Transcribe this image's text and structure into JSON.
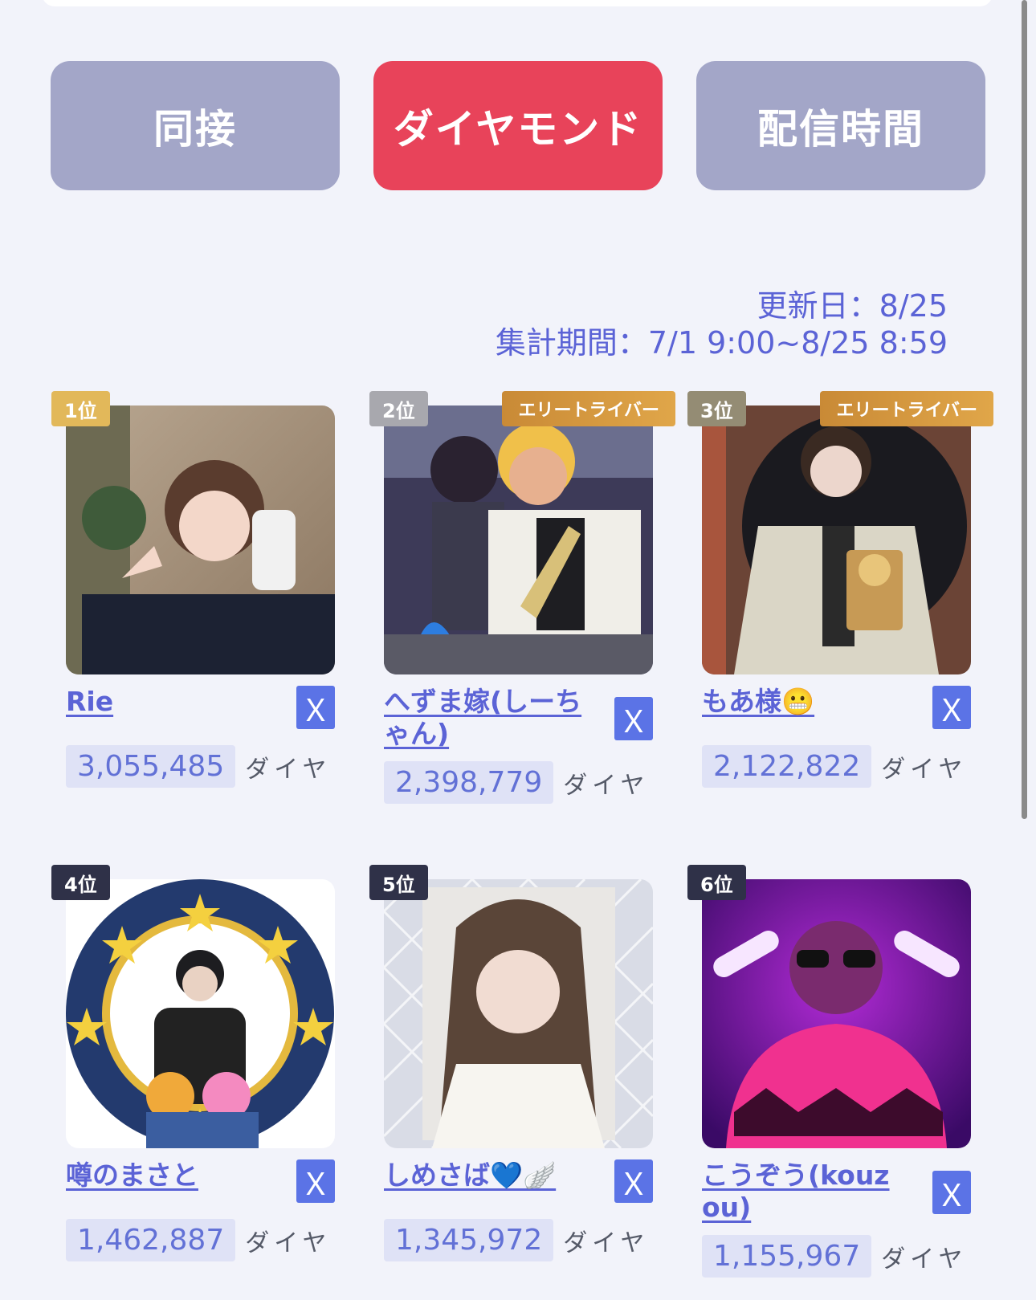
{
  "tabs": [
    {
      "label": "同接",
      "active": false
    },
    {
      "label": "ダイヤモンド",
      "active": true
    },
    {
      "label": "配信時間",
      "active": false
    }
  ],
  "updated": "更新日：8/25",
  "period": "集計期間：7/1 9:00~8/25 8:59",
  "unit_label": "ダイヤ",
  "x_icon": "Ｘ",
  "colors": {
    "active_tab": "#e8435a",
    "inactive_tab": "#a3a6c8",
    "accent": "#5b63d6",
    "elite_badge": "#d9993f"
  },
  "entries": [
    {
      "rank": "1位",
      "name": "Rie",
      "score": "3,055,485",
      "elite": ""
    },
    {
      "rank": "2位",
      "name": "へずま嫁(しーちゃん)",
      "score": "2,398,779",
      "elite": "エリートライバー"
    },
    {
      "rank": "3位",
      "name": "もあ様😬",
      "score": "2,122,822",
      "elite": "エリートライバー"
    },
    {
      "rank": "4位",
      "name": "噂のまさと",
      "score": "1,462,887",
      "elite": ""
    },
    {
      "rank": "5位",
      "name": "しめさば💙🪽",
      "score": "1,345,972",
      "elite": ""
    },
    {
      "rank": "6位",
      "name": "こうぞう(kouzou)",
      "score": "1,155,967",
      "elite": ""
    }
  ]
}
